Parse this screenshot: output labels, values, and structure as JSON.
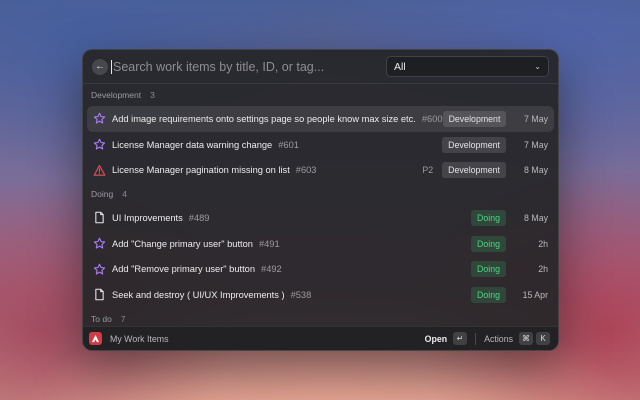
{
  "search": {
    "placeholder": "Search work items by title, ID, or tag..."
  },
  "filter": {
    "selected": "All"
  },
  "sections": [
    {
      "name": "Development",
      "count": "3",
      "items": [
        {
          "title": "Add image requirements onto settings page so people know max size etc.",
          "id": "#600",
          "priority": "",
          "status": "Development",
          "date": "7 May",
          "icon": "star-icon",
          "selected": true
        },
        {
          "title": "License Manager data warning change",
          "id": "#601",
          "priority": "",
          "status": "Development",
          "date": "7 May",
          "icon": "star-icon"
        },
        {
          "title": "License Manager pagination missing on list",
          "id": "#603",
          "priority": "P2",
          "status": "Development",
          "date": "8 May",
          "icon": "warning-icon"
        }
      ]
    },
    {
      "name": "Doing",
      "count": "4",
      "items": [
        {
          "title": "UI Improvements",
          "id": "#489",
          "priority": "",
          "status": "Doing",
          "date": "8 May",
          "icon": "document-icon"
        },
        {
          "title": "Add \"Change primary user\" button",
          "id": "#491",
          "priority": "",
          "status": "Doing",
          "date": "2h",
          "icon": "star-icon"
        },
        {
          "title": "Add \"Remove primary user\" button",
          "id": "#492",
          "priority": "",
          "status": "Doing",
          "date": "2h",
          "icon": "star-icon"
        },
        {
          "title": "Seek and destroy ( UI/UX Improvements )",
          "id": "#538",
          "priority": "",
          "status": "Doing",
          "date": "15 Apr",
          "icon": "document-icon"
        }
      ]
    },
    {
      "name": "To do",
      "count": "7",
      "items": []
    }
  ],
  "footer": {
    "title": "My Work Items",
    "open_label": "Open",
    "open_key": "↵",
    "actions_label": "Actions",
    "actions_key_1": "⌘",
    "actions_key_2": "K"
  },
  "colors": {
    "accent_star": "#a57cf0",
    "warning": "#e0505a",
    "doing": "#4fd486",
    "logo": "#d23a44"
  }
}
